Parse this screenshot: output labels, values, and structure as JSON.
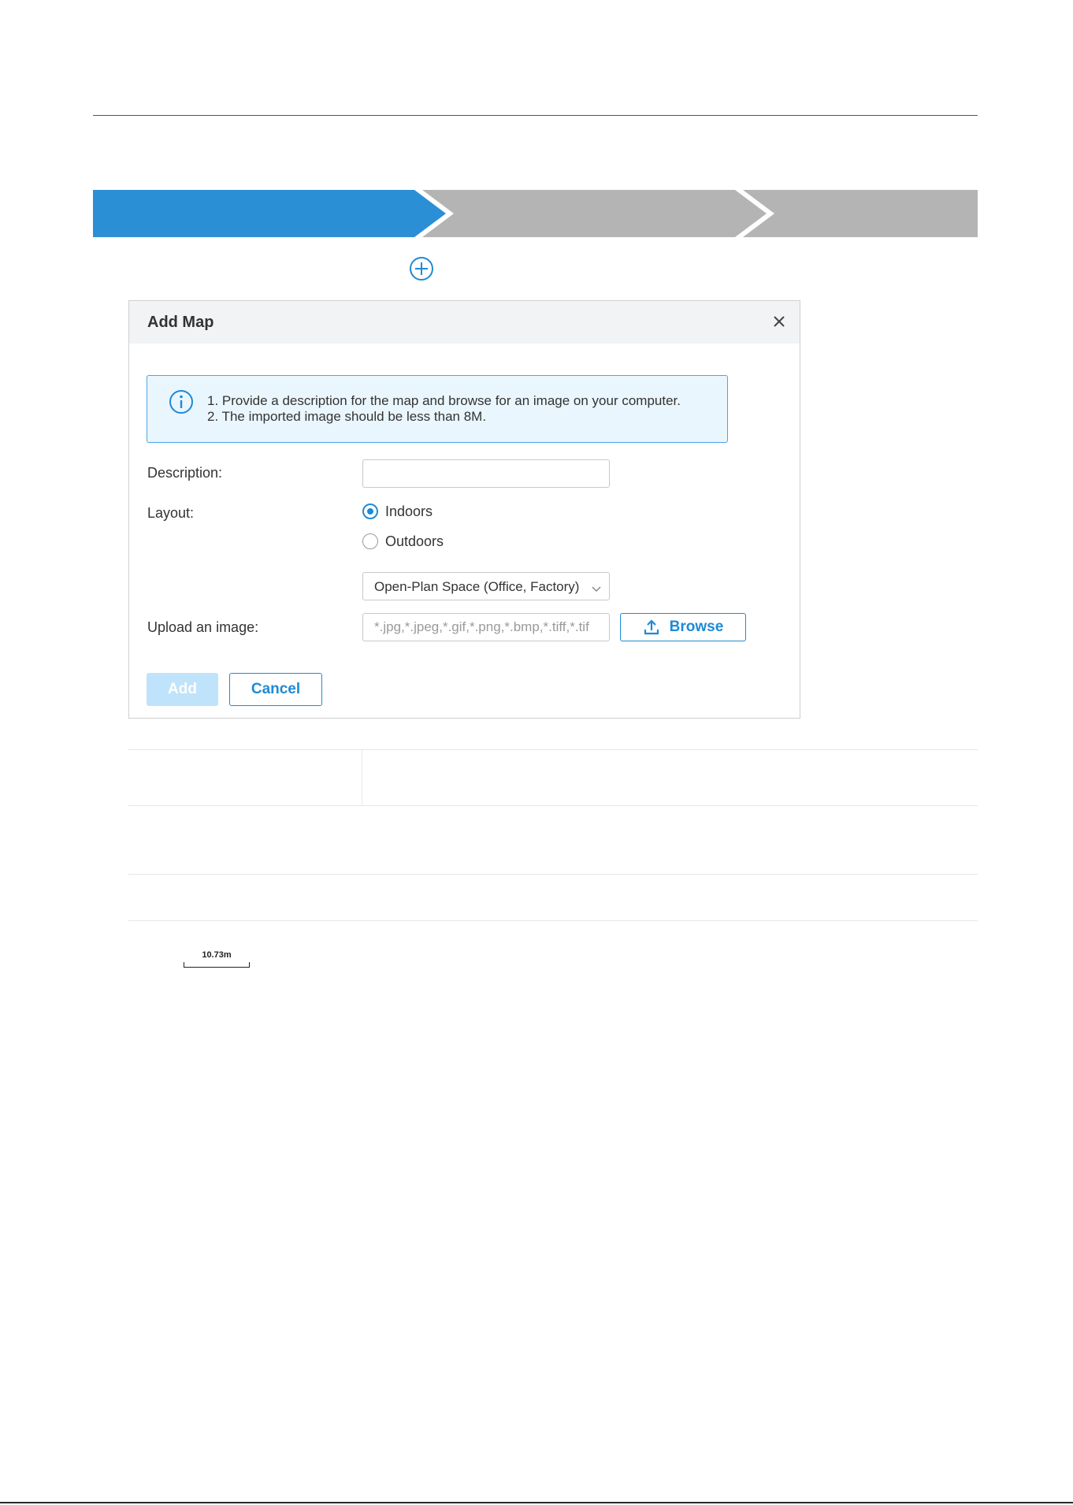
{
  "colors": {
    "accent": "#1e8ad6",
    "step_active": "#2b8fd6",
    "step_inactive": "#b4b4b4",
    "info_bg": "#eaf6fd",
    "disabled_button": "#bfe3fb"
  },
  "stepper": {
    "steps": [
      {
        "state": "active"
      },
      {
        "state": "inactive"
      },
      {
        "state": "inactive"
      }
    ]
  },
  "toolbar": {
    "add_icon": "plus-circle-icon"
  },
  "dialog": {
    "title": "Add Map",
    "close_icon": "close-icon",
    "info": {
      "icon": "info-icon",
      "lines": [
        "1. Provide a description for the map and browse for an image on your computer.",
        "2. The imported image should be less than 8M."
      ]
    },
    "form": {
      "description_label": "Description:",
      "description_value": "",
      "layout_label": "Layout:",
      "layout_options": [
        {
          "label": "Indoors",
          "checked": true
        },
        {
          "label": "Outdoors",
          "checked": false
        }
      ],
      "space_type_selected": "Open-Plan Space (Office, Factory)",
      "upload_label": "Upload an image:",
      "upload_placeholder": "*.jpg,*.jpeg,*.gif,*.png,*.bmp,*.tiff,*.tif",
      "browse_label": "Browse",
      "browse_icon": "upload-icon"
    },
    "buttons": {
      "add_label": "Add",
      "cancel_label": "Cancel"
    }
  },
  "map": {
    "scale_label": "10.73m"
  }
}
